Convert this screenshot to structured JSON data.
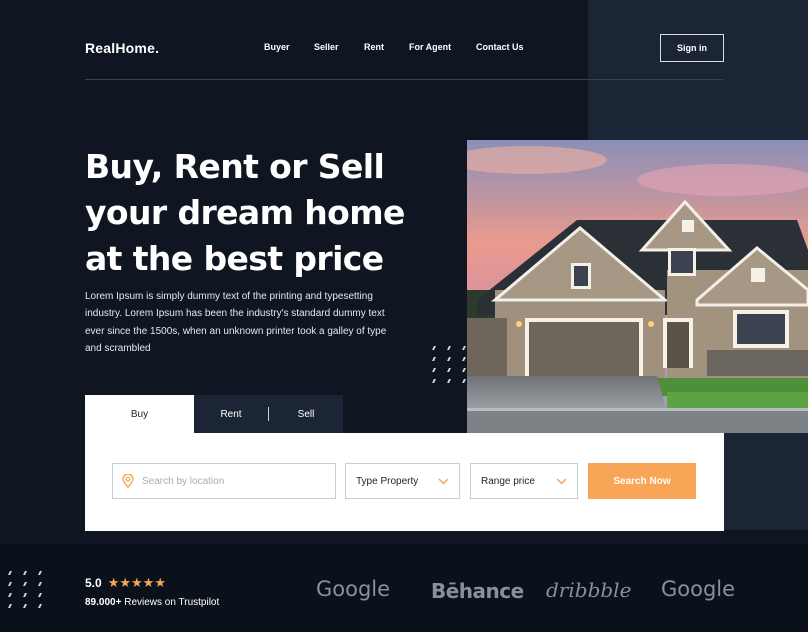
{
  "brand": {
    "logo": "RealHome."
  },
  "nav": {
    "items": [
      "Buyer",
      "Seller",
      "Rent",
      "For Agent",
      "Contact Us"
    ],
    "signin": "Sign in"
  },
  "hero": {
    "title_lines": [
      "Buy, Rent or Sell",
      "your dream home",
      "at the best price"
    ],
    "description": "Lorem Ipsum is simply dummy text of the printing and typesetting industry. Lorem Ipsum has been the industry's standard dummy text ever since the 1500s, when an unknown printer took a galley of type and scrambled"
  },
  "tabs": {
    "buy": "Buy",
    "rent": "Rent",
    "sell": "Sell",
    "active": "Buy"
  },
  "search": {
    "location_placeholder": "Search by location",
    "type_property": "Type Property",
    "range_price": "Range price",
    "button": "Search Now"
  },
  "rating": {
    "score": "5.0",
    "stars": 5,
    "reviews_count": "89.000+",
    "reviews_text": "Reviews on Trustpilot"
  },
  "partners": [
    "Google",
    "Bēhance",
    "dribbble",
    "Google"
  ],
  "colors": {
    "background": "#0f1621",
    "panel": "#1c2535",
    "accent": "#f9a557"
  },
  "icons": {
    "location": "location-pin-icon",
    "chevron": "chevron-down-icon",
    "star": "star-icon"
  }
}
